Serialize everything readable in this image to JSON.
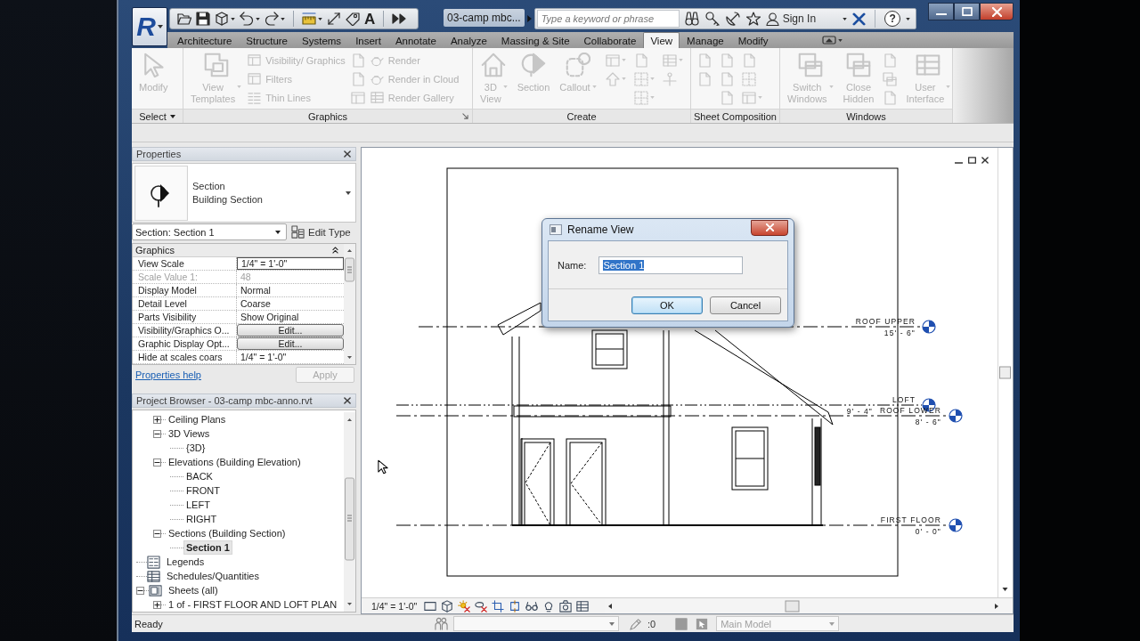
{
  "window": {
    "app_logo": "R",
    "title": "03-camp mbc...",
    "search_placeholder": "Type a keyword or phrase",
    "sign_in": "Sign In",
    "help": "?"
  },
  "quick_access": [
    {
      "kind": "icon",
      "dropdown": false
    },
    {
      "kind": "icon",
      "dropdown": false
    },
    {
      "kind": "icon",
      "dropdown": true
    },
    {
      "kind": "icon",
      "dropdown": true
    },
    {
      "kind": "icon",
      "dropdown": true
    },
    {
      "kind": "icon",
      "dropdown": true
    },
    {
      "kind": "icon",
      "dropdown": false
    },
    {
      "kind": "icon",
      "dropdown": false
    },
    {
      "kind": "glyph",
      "label": "A",
      "dropdown": false
    },
    {
      "kind": "icon",
      "dropdown": false
    }
  ],
  "tabs": [
    {
      "label": "Architecture",
      "selected": false
    },
    {
      "label": "Structure",
      "selected": false
    },
    {
      "label": "Systems",
      "selected": false
    },
    {
      "label": "Insert",
      "selected": false
    },
    {
      "label": "Annotate",
      "selected": false
    },
    {
      "label": "Analyze",
      "selected": false
    },
    {
      "label": "Massing & Site",
      "selected": false
    },
    {
      "label": "Collaborate",
      "selected": false
    },
    {
      "label": "View",
      "selected": true
    },
    {
      "label": "Manage",
      "selected": false
    },
    {
      "label": "Modify",
      "selected": false
    }
  ],
  "ribbon": {
    "panels": [
      {
        "title": "Select",
        "menu": true,
        "launcher": false,
        "columns": [
          {
            "tools": [
              {
                "kind": "large",
                "label": "Modify",
                "dropdown": false,
                "disabled": true
              }
            ]
          }
        ]
      },
      {
        "title": "Graphics",
        "menu": false,
        "launcher": true,
        "columns": [
          {
            "tools": [
              {
                "kind": "large",
                "label": "View Templates",
                "dropdown": true,
                "disabled": true
              }
            ]
          },
          {
            "tools": [
              {
                "kind": "small",
                "label": "Visibility/ Graphics",
                "dropdown": false,
                "disabled": true
              },
              {
                "kind": "small",
                "label": "Filters",
                "dropdown": false,
                "disabled": true
              },
              {
                "kind": "small",
                "label": "Thin Lines",
                "dropdown": false,
                "disabled": true
              }
            ]
          },
          {
            "tools": [
              {
                "kind": "icon",
                "dropdown": false,
                "disabled": true
              },
              {
                "kind": "icon",
                "dropdown": false,
                "disabled": true
              },
              {
                "kind": "icon",
                "dropdown": false,
                "disabled": true
              }
            ]
          },
          {
            "tools": [
              {
                "kind": "small",
                "label": "Render",
                "dropdown": false,
                "disabled": true
              },
              {
                "kind": "small",
                "label": "Render in Cloud",
                "dropdown": false,
                "disabled": true
              },
              {
                "kind": "small",
                "label": "Render Gallery",
                "dropdown": false,
                "disabled": true
              }
            ]
          }
        ]
      },
      {
        "title": "Create",
        "menu": false,
        "launcher": false,
        "columns": [
          {
            "tools": [
              {
                "kind": "large",
                "label": "3D View",
                "dropdown": true,
                "disabled": true
              }
            ]
          },
          {
            "tools": [
              {
                "kind": "large",
                "label": "Section",
                "dropdown": false,
                "disabled": true
              }
            ]
          },
          {
            "tools": [
              {
                "kind": "large",
                "label": "Callout",
                "dropdown": true,
                "disabled": true
              }
            ]
          },
          {
            "tools": [
              {
                "kind": "icon",
                "dropdown": true,
                "disabled": true
              },
              {
                "kind": "icon",
                "dropdown": true,
                "disabled": true
              }
            ]
          },
          {
            "tools": [
              {
                "kind": "icon",
                "dropdown": false,
                "disabled": true
              },
              {
                "kind": "icon",
                "dropdown": true,
                "disabled": true
              },
              {
                "kind": "icon",
                "dropdown": true,
                "disabled": true
              }
            ]
          },
          {
            "tools": [
              {
                "kind": "icon",
                "dropdown": true,
                "disabled": true
              },
              {
                "kind": "icon",
                "dropdown": false,
                "disabled": true
              }
            ]
          }
        ]
      },
      {
        "title": "Sheet Composition",
        "menu": false,
        "launcher": false,
        "columns": [
          {
            "tools": [
              {
                "kind": "icon",
                "dropdown": false,
                "disabled": true
              },
              {
                "kind": "icon",
                "dropdown": false,
                "disabled": true
              }
            ]
          },
          {
            "tools": [
              {
                "kind": "icon",
                "dropdown": false,
                "disabled": true
              },
              {
                "kind": "icon",
                "dropdown": false,
                "disabled": true
              },
              {
                "kind": "icon",
                "dropdown": false,
                "disabled": true
              }
            ]
          },
          {
            "tools": [
              {
                "kind": "icon",
                "dropdown": false,
                "disabled": true
              },
              {
                "kind": "icon",
                "dropdown": false,
                "disabled": true
              },
              {
                "kind": "icon",
                "dropdown": true,
                "disabled": true
              }
            ]
          }
        ]
      },
      {
        "title": "Windows",
        "menu": false,
        "launcher": false,
        "columns": [
          {
            "tools": [
              {
                "kind": "large",
                "label": "Switch Windows",
                "dropdown": true,
                "disabled": true
              }
            ]
          },
          {
            "tools": [
              {
                "kind": "large",
                "label": "Close Hidden",
                "dropdown": false,
                "disabled": true
              }
            ]
          },
          {
            "tools": [
              {
                "kind": "icon",
                "dropdown": false,
                "disabled": true
              },
              {
                "kind": "icon",
                "dropdown": false,
                "disabled": true
              },
              {
                "kind": "icon",
                "dropdown": false,
                "disabled": true
              }
            ]
          },
          {
            "tools": [
              {
                "kind": "large",
                "label": "User Interface",
                "dropdown": true,
                "disabled": true
              }
            ]
          }
        ]
      }
    ]
  },
  "properties": {
    "title": "Properties",
    "type": {
      "category": "Section",
      "name": "Building Section"
    },
    "instance": "Section: Section 1",
    "edit_type": "Edit Type",
    "group": {
      "label": "Graphics",
      "expanded": true
    },
    "rows": [
      {
        "name": "View Scale",
        "value": "1/4\" = 1'-0\"",
        "kind": "field",
        "disabled": false
      },
      {
        "name": "Scale Value 1:",
        "value": "48",
        "kind": "text",
        "disabled": true
      },
      {
        "name": "Display Model",
        "value": "Normal",
        "kind": "text",
        "disabled": false
      },
      {
        "name": "Detail Level",
        "value": "Coarse",
        "kind": "text",
        "disabled": false
      },
      {
        "name": "Parts Visibility",
        "value": "Show Original",
        "kind": "text",
        "disabled": false
      },
      {
        "name": "Visibility/Graphics O...",
        "value": "Edit...",
        "kind": "button",
        "disabled": false
      },
      {
        "name": "Graphic Display Opt...",
        "value": "Edit...",
        "kind": "button",
        "disabled": false
      },
      {
        "name": "Hide at scales coars",
        "value": "1/4\" = 1'-0\"",
        "kind": "text",
        "disabled": false
      }
    ],
    "help_link": "Properties help",
    "apply": {
      "label": "Apply",
      "disabled": true
    }
  },
  "project_browser": {
    "title": "Project Browser - 03-camp mbc-anno.rvt",
    "tree": [
      {
        "children": [
          {
            "label": "Ceiling Plans",
            "kind": "folder",
            "expanded": false,
            "selected": false
          },
          {
            "label": "3D Views",
            "kind": "folder",
            "expanded": true,
            "selected": false,
            "children": [
              {
                "label": "{3D}",
                "kind": "view",
                "selected": false
              }
            ]
          },
          {
            "label": "Elevations (Building Elevation)",
            "kind": "folder",
            "expanded": true,
            "selected": false,
            "children": [
              {
                "label": "BACK",
                "kind": "view",
                "selected": false
              },
              {
                "label": "FRONT",
                "kind": "view",
                "selected": false
              },
              {
                "label": "LEFT",
                "kind": "view",
                "selected": false
              },
              {
                "label": "RIGHT",
                "kind": "view",
                "selected": false
              }
            ]
          },
          {
            "label": "Sections (Building Section)",
            "kind": "folder",
            "expanded": true,
            "selected": false,
            "children": [
              {
                "label": "Section 1",
                "kind": "view",
                "selected": true
              }
            ]
          }
        ]
      },
      {
        "label": "Legends",
        "kind": "legends",
        "selected": false
      },
      {
        "label": "Schedules/Quantities",
        "kind": "schedules",
        "selected": false
      },
      {
        "label": "Sheets (all)",
        "kind": "sheets",
        "expanded": true,
        "selected": false,
        "children": [
          {
            "label": "1 of - FIRST FLOOR AND LOFT PLAN",
            "kind": "folder",
            "expanded": false,
            "selected": false
          }
        ]
      }
    ]
  },
  "view": {
    "levels": [
      {
        "name": "ROOF UPPER",
        "elevation": "15' - 6\""
      },
      {
        "name": "LOFT",
        "elevation": "9' - 4\""
      },
      {
        "name": "ROOF LOWER",
        "elevation": "8' - 6\""
      },
      {
        "name": "FIRST FLOOR",
        "elevation": "0' - 0\""
      }
    ],
    "scale": "1/4\" = 1'-0\""
  },
  "dialog": {
    "title": "Rename View",
    "name_label": "Name:",
    "name_value": "Section 1",
    "value_selected": true,
    "buttons": [
      {
        "label": "OK",
        "default": true
      },
      {
        "label": "Cancel",
        "default": false
      }
    ]
  },
  "status_bar": {
    "message": "Ready",
    "workset_count": ":0",
    "model": "Main Model",
    "model_disabled": true
  }
}
